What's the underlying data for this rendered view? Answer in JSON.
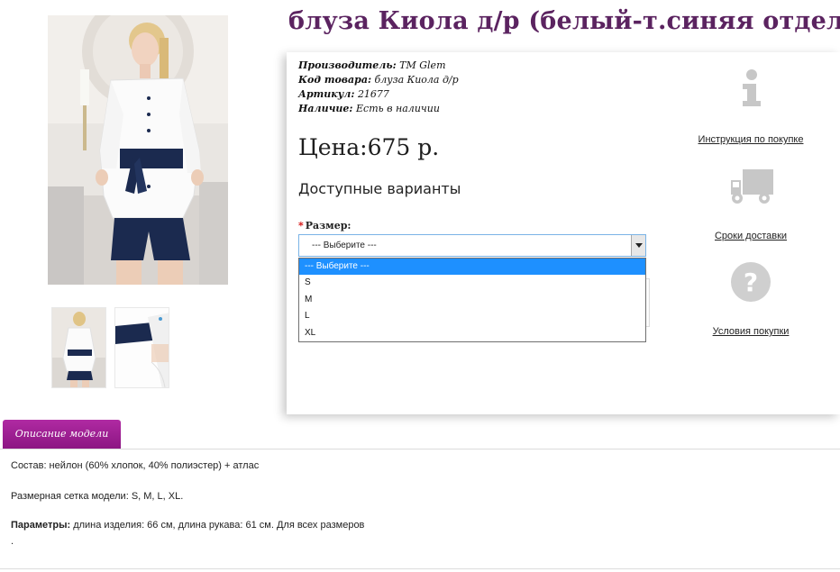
{
  "product": {
    "title": "блуза Киола д/р (белый-т.синяя отделка)",
    "manufacturer_label": "Производитель:",
    "manufacturer": "TM Glem",
    "code_label": "Код товара:",
    "code": "блуза Киола д/р",
    "sku_label": "Артикул:",
    "sku": "21677",
    "stock_label": "Наличие:",
    "stock": "Есть в наличии",
    "price": "Цена:675 р."
  },
  "options": {
    "heading": "Доступные варианты",
    "required_mark": "*",
    "size_label": "Размер:",
    "selected": "--- Выберите ---",
    "items": [
      "--- Выберите ---",
      "S",
      "M",
      "L",
      "XL"
    ]
  },
  "side_links": {
    "instructions": "Инструкция по покупке",
    "delivery": "Сроки доставки",
    "terms": "Условия покупки"
  },
  "tabs": {
    "description": "Описание модели"
  },
  "description": {
    "composition": "Состав: нейлон (60% хлопок, 40% полиэстер) + атлас",
    "sizes": "Размерная сетка модели: S, M, L, XL.",
    "params_label": "Параметры:",
    "params": " длина изделия: 66 см, длина рукава: 61 см. Для всех размеров",
    "dot": "."
  },
  "colors": {
    "title": "#5b2360",
    "tab": "#9a1a8f",
    "selected_option": "#1e90ff"
  },
  "icons": [
    "info-icon",
    "truck-icon",
    "question-icon"
  ]
}
